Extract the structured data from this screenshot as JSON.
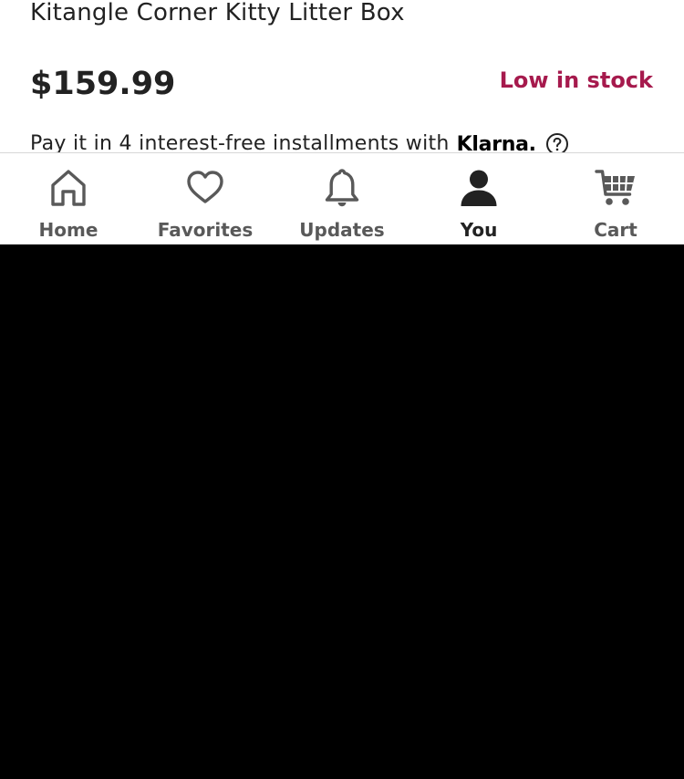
{
  "product": {
    "title": "Kitangle Corner Kitty Litter Box",
    "price": "$159.99",
    "stock_status": "Low in stock"
  },
  "installments": {
    "text": "Pay it in 4 interest-free installments with",
    "provider": "Klarna.",
    "help_icon": "question-circle-icon"
  },
  "nav": {
    "items": [
      {
        "label": "Home",
        "icon": "home-icon",
        "active": false
      },
      {
        "label": "Favorites",
        "icon": "heart-icon",
        "active": false
      },
      {
        "label": "Updates",
        "icon": "bell-icon",
        "active": false
      },
      {
        "label": "You",
        "icon": "person-icon",
        "active": true
      },
      {
        "label": "Cart",
        "icon": "cart-icon",
        "active": false
      }
    ]
  },
  "colors": {
    "stock_status": "#a61a4d",
    "text_primary": "#222222",
    "text_secondary": "#595959",
    "icon_inactive": "#595959",
    "background": "#ffffff",
    "below_fold": "#000000"
  }
}
